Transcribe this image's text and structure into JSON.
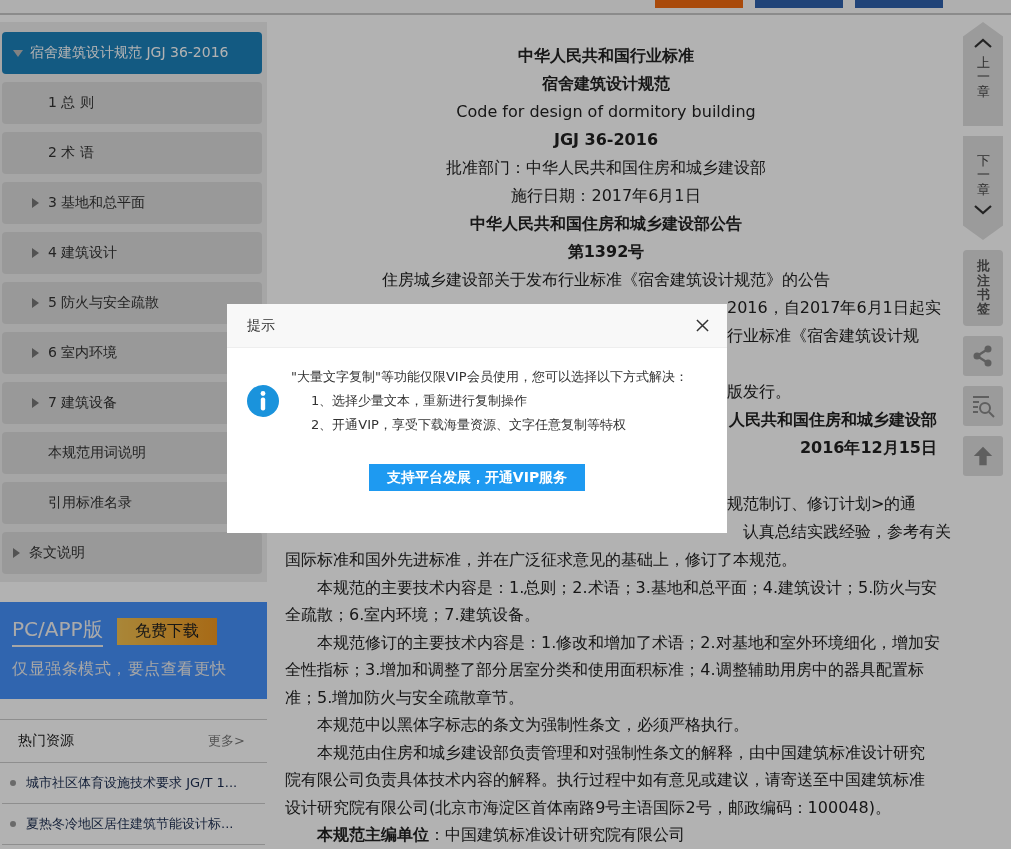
{
  "header": {
    "buttons": [
      {
        "kind": "orange"
      },
      {
        "kind": "blue"
      },
      {
        "kind": "blue"
      }
    ]
  },
  "sidebar": {
    "items": [
      {
        "label": "宿舍建筑设计规范 JGJ 36-2016",
        "kind": "section",
        "expanded": true,
        "selected": true,
        "children": [
          {
            "label": "1 总 则",
            "kind": "leaf",
            "selected": false
          },
          {
            "label": "2 术 语",
            "kind": "leaf",
            "selected": false
          },
          {
            "label": "3 基地和总平面",
            "kind": "section",
            "expanded": false,
            "selected": false
          },
          {
            "label": "4 建筑设计",
            "kind": "section",
            "expanded": false,
            "selected": false
          },
          {
            "label": "5 防火与安全疏散",
            "kind": "section",
            "expanded": false,
            "selected": false
          },
          {
            "label": "6 室内环境",
            "kind": "section",
            "expanded": false,
            "selected": false
          },
          {
            "label": "7 建筑设备",
            "kind": "section",
            "expanded": false,
            "selected": false
          },
          {
            "label": "本规范用词说明",
            "kind": "leaf",
            "selected": false
          },
          {
            "label": "引用标准名录",
            "kind": "leaf",
            "selected": false
          }
        ]
      },
      {
        "label": "条文说明",
        "kind": "section",
        "expanded": false,
        "selected": false
      }
    ]
  },
  "banner": {
    "title": "PC/APP版",
    "button": "免费下载",
    "subtitle": "仅显强条模式，要点查看更快"
  },
  "hot_resources": {
    "title": "热门资源",
    "more": "更多>",
    "items": [
      "城市社区体育设施技术要求 JG/T 1...",
      "夏热冬冷地区居住建筑节能设计标..."
    ]
  },
  "document": {
    "headings": [
      {
        "text": "中华人民共和国行业标准",
        "kind": "bold"
      },
      {
        "text": "宿舍建筑设计规范",
        "kind": "bold"
      },
      {
        "text": "Code for design of dormitory building",
        "kind": "plain"
      },
      {
        "text": "JGJ 36-2016",
        "kind": "bold"
      },
      {
        "text": "批准部门：中华人民共和国住房和城乡建设部",
        "kind": "plain"
      },
      {
        "text": "施行日期：2017年6月1日",
        "kind": "plain"
      },
      {
        "text": "中华人民共和国住房和城乡建设部公告",
        "kind": "bold"
      },
      {
        "text": "第1392号",
        "kind": "bold"
      },
      {
        "text": "住房城乡建设部关于发布行业标准《宿舍建筑设计规范》的公告",
        "kind": "plain"
      }
    ],
    "fragments": [
      {
        "text": "2016，自2017年6月1日起实",
        "kind": "tail"
      },
      {
        "text": "行业标准《宿舍建筑设计规",
        "kind": "tail"
      },
      {
        "text": "版发行。",
        "kind": "tail"
      },
      {
        "text": "人民共和国住房和城乡建设部",
        "kind": "signature"
      },
      {
        "text": "2016年12月15日",
        "kind": "signature"
      },
      {
        "text": "规范制订、修订计划>的通",
        "kind": "tail"
      },
      {
        "text": "认真总结实践经验，参考有关",
        "kind": "tail"
      }
    ],
    "paragraphs": [
      {
        "text": "国际标准和国外先进标准，并在广泛征求意见的基础上，修订了本规范。",
        "kind": "continuation"
      },
      {
        "text": "本规范的主要技术内容是：1.总则；2.术语；3.基地和总平面；4.建筑设计；5.防火与安全疏散；6.室内环境；7.建筑设备。",
        "kind": "paragraph"
      },
      {
        "text": "本规范修订的主要技术内容是：1.修改和增加了术语；2.对基地和室外环境细化，增加安全性指标；3.增加和调整了部分居室分类和使用面积标准；4.调整辅助用房中的器具配置标准；5.增加防火与安全疏散章节。",
        "kind": "paragraph"
      },
      {
        "text": "本规范中以黑体字标志的条文为强制性条文，必须严格执行。",
        "kind": "paragraph"
      },
      {
        "text": "本规范由住房和城乡建设部负责管理和对强制性条文的解释，由中国建筑标准设计研究院有限公司负责具体技术内容的解释。执行过程中如有意见或建议，请寄送至中国建筑标准设计研究院有限公司(北京市海淀区首体南路9号主语国际2号，邮政编码：100048)。",
        "kind": "paragraph"
      },
      {
        "text": "**本规范主编单位**：中国建筑标准设计研究院有限公司",
        "kind": "paragraph"
      }
    ]
  },
  "side_rail": {
    "prev": "上一章",
    "next": "下一章",
    "notes": "批注书签"
  },
  "dialog": {
    "title": "提示",
    "message": "\"大量文字复制\"等功能仅限VIP会员使用，您可以选择以下方式解决：",
    "options": [
      "1、选择少量文本，重新进行复制操作",
      "2、开通VIP，享受下载海量资源、文字任意复制等特权"
    ],
    "button": "支持平台发展，开通VIP服务"
  }
}
